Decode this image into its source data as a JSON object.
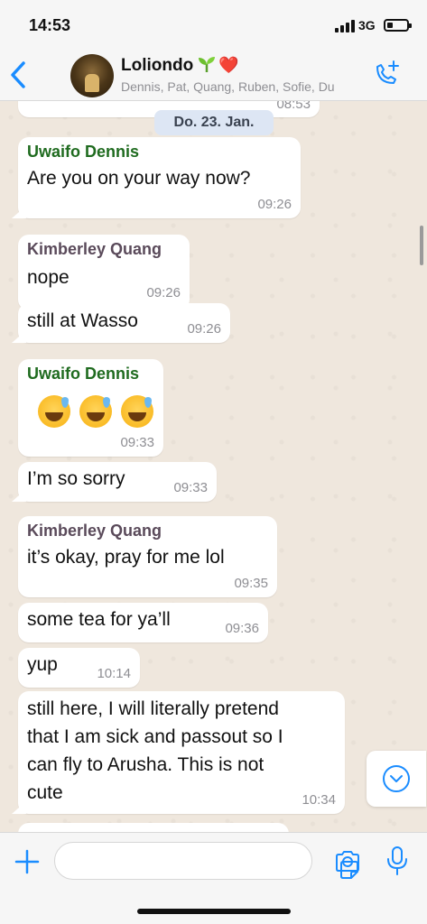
{
  "status_bar": {
    "time": "14:53",
    "network": "3G"
  },
  "header": {
    "group_name": "Loliondo",
    "heart": "❤️",
    "members": "Dennis, Pat, Quang, Ruben, Sofie, Du"
  },
  "chat": {
    "partial_top_ts": "08:53",
    "date_chip": "Do. 23. Jan.",
    "messages": [
      {
        "sender": "Uwaifo Dennis",
        "text": "Are you on your way now?",
        "time": "09:26"
      },
      {
        "sender": "Kimberley Quang",
        "text": "nope",
        "time": "09:26"
      },
      {
        "text": "still at Wasso",
        "time": "09:26"
      },
      {
        "sender": "Uwaifo Dennis",
        "text": "",
        "time": "09:33"
      },
      {
        "text": "I’m so sorry",
        "time": "09:33"
      },
      {
        "sender": "Kimberley Quang",
        "text": "it’s okay, pray for me lol",
        "time": "09:35"
      },
      {
        "text": "some tea for ya’ll",
        "time": "09:36"
      },
      {
        "text": "yup",
        "time": "10:14"
      },
      {
        "text_lines": [
          "still here, I will literally pretend",
          "that I am sick and passout so I",
          "can fly to Arusha. This is not",
          "cute"
        ],
        "time": "10:34"
      }
    ]
  },
  "colors": {
    "dennis": "#1f6b1f",
    "quang": "#5a4a5a",
    "accent": "#1a8cff",
    "chat_bg": "#efe7dd"
  },
  "input_bar": {
    "placeholder": ""
  }
}
